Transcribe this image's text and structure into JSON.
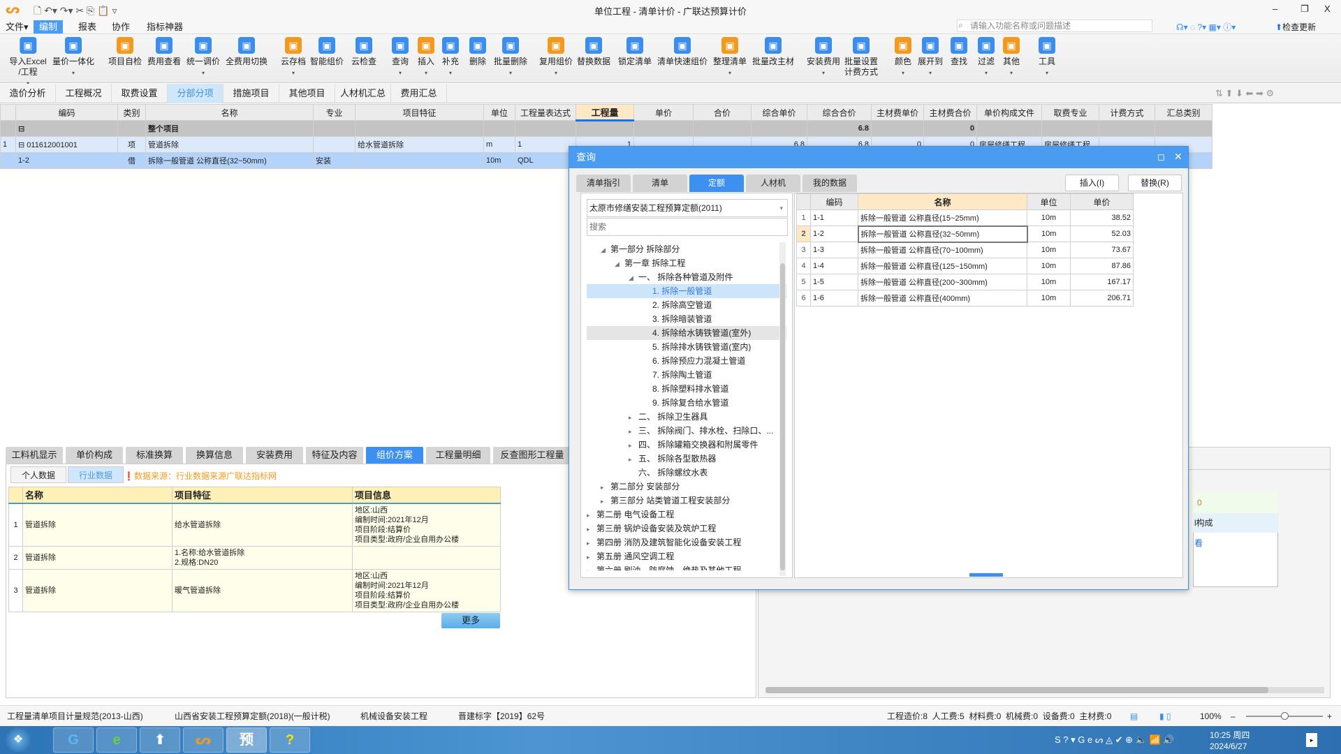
{
  "window": {
    "title": "单位工程 - 清单计价 - 广联达预算计价",
    "search_placeholder": "请输入功能名称或问题描述",
    "check_update": "检查更新"
  },
  "menu": [
    {
      "label": "文件▾"
    },
    {
      "label": "编制",
      "active": true
    },
    {
      "label": "报表"
    },
    {
      "label": "协作"
    },
    {
      "label": "指标神器"
    }
  ],
  "ribbon": [
    {
      "label": "导入Excel\n/工程",
      "icon": "import-excel-icon",
      "dropdown": true
    },
    {
      "label": "量价一体化",
      "icon": "price-integration-icon",
      "dropdown": true
    },
    {
      "label": "项目自检",
      "icon": "self-check-icon"
    },
    {
      "label": "费用查看",
      "icon": "cost-view-icon"
    },
    {
      "label": "统一调价",
      "icon": "adjust-price-icon",
      "dropdown": true
    },
    {
      "label": "全费用切换",
      "icon": "full-cost-switch-icon"
    },
    {
      "label": "云存档",
      "icon": "cloud-upload-icon",
      "dropdown": true
    },
    {
      "label": "智能组价",
      "icon": "smart-pricing-icon"
    },
    {
      "label": "云检查",
      "icon": "cloud-check-icon"
    },
    {
      "label": "查询",
      "icon": "query-icon",
      "dropdown": true
    },
    {
      "label": "插入",
      "icon": "insert-icon",
      "dropdown": true
    },
    {
      "label": "补充",
      "icon": "supplement-icon",
      "dropdown": true
    },
    {
      "label": "删除",
      "icon": "trash-icon"
    },
    {
      "label": "批量删除",
      "icon": "batch-delete-icon",
      "dropdown": true
    },
    {
      "label": "复用组价",
      "icon": "reuse-pricing-icon",
      "dropdown": true
    },
    {
      "label": "替换数据",
      "icon": "replace-data-icon"
    },
    {
      "label": "锁定清单",
      "icon": "lock-icon"
    },
    {
      "label": "清单快速组价",
      "icon": "quick-pricing-icon"
    },
    {
      "label": "整理清单",
      "icon": "organize-list-icon",
      "dropdown": true
    },
    {
      "label": "批量改主材",
      "icon": "batch-edit-material-icon"
    },
    {
      "label": "安装费用",
      "icon": "install-cost-icon",
      "dropdown": true
    },
    {
      "label": "批量设置\n计费方式",
      "icon": "fee-method-icon"
    },
    {
      "label": "颜色",
      "icon": "color-icon",
      "dropdown": true
    },
    {
      "label": "展开到",
      "icon": "expand-to-icon",
      "dropdown": true
    },
    {
      "label": "查找",
      "icon": "find-icon"
    },
    {
      "label": "过滤",
      "icon": "filter-icon",
      "dropdown": true
    },
    {
      "label": "其他",
      "icon": "other-icon",
      "dropdown": true
    },
    {
      "label": "工具",
      "icon": "tools-icon",
      "dropdown": true
    }
  ],
  "nav_tabs": [
    {
      "label": "造价分析"
    },
    {
      "label": "工程概况"
    },
    {
      "label": "取费设置"
    },
    {
      "label": "分部分项",
      "active": true
    },
    {
      "label": "措施项目"
    },
    {
      "label": "其他项目"
    },
    {
      "label": "人材机汇总"
    },
    {
      "label": "费用汇总"
    }
  ],
  "main_table": {
    "columns": [
      "",
      "编码",
      "类别",
      "名称",
      "专业",
      "项目特征",
      "单位",
      "工程量表达式",
      "工程量",
      "单价",
      "合价",
      "综合单价",
      "综合合价",
      "主材费单价",
      "主材费合价",
      "单价构成文件",
      "取费专业",
      "计费方式",
      "汇总类别"
    ],
    "rows": [
      {
        "cells": [
          "",
          "⊟",
          "",
          "整个项目",
          "",
          "",
          "",
          "",
          "",
          "",
          "",
          "",
          "6.8",
          "",
          "0",
          "",
          "",
          "",
          ""
        ]
      },
      {
        "cells": [
          "1",
          "⊟ 011612001001",
          "项",
          "管道拆除",
          "",
          "给水管道拆除",
          "m",
          "1",
          "1",
          "",
          "",
          "6.8",
          "6.8",
          "0",
          "0",
          "房屋修缮工程",
          "房屋修缮工程",
          "",
          ""
        ]
      },
      {
        "cells": [
          "",
          "1-2",
          "借",
          "拆除一般管道 公称直径(32~50mm)",
          "安装",
          "",
          "10m",
          "QDL",
          "",
          "",
          "",
          "",
          "",
          "",
          "",
          "",
          "",
          "",
          ""
        ]
      }
    ]
  },
  "dialog": {
    "title": "查询",
    "tabs": [
      {
        "label": "清单指引"
      },
      {
        "label": "清单"
      },
      {
        "label": "定额",
        "active": true
      },
      {
        "label": "人材机"
      },
      {
        "label": "我的数据"
      }
    ],
    "insert_button": "插入(I)",
    "replace_button": "替换(R)",
    "quota_library": "太原市修缮安装工程预算定额(2011)",
    "search_placeholder": "搜索",
    "tree": [
      {
        "label": "第一部分 拆除部分",
        "level": 2,
        "expander": "◢"
      },
      {
        "label": "第一章 拆除工程",
        "level": 3,
        "expander": "◢"
      },
      {
        "label": "一、 拆除各种管道及附件",
        "level": 4,
        "expander": "◢"
      },
      {
        "label": "1. 拆除一般管道",
        "level": 5,
        "selected": true
      },
      {
        "label": "2. 拆除高空管道",
        "level": 5
      },
      {
        "label": "3. 拆除暗装管道",
        "level": 5
      },
      {
        "label": "4. 拆除给水铸铁管道(室外)",
        "level": 5,
        "hover": true
      },
      {
        "label": "5. 拆除排水铸铁管道(室内)",
        "level": 5
      },
      {
        "label": "6. 拆除预应力混凝土管道",
        "level": 5
      },
      {
        "label": "7. 拆除陶土管道",
        "level": 5
      },
      {
        "label": "8. 拆除塑料排水管道",
        "level": 5
      },
      {
        "label": "9. 拆除复合给水管道",
        "level": 5
      },
      {
        "label": "二、 拆除卫生器具",
        "level": 4,
        "expander": "▸"
      },
      {
        "label": "三、 拆除阀门、排水栓、扫除口、...",
        "level": 4,
        "expander": "▸"
      },
      {
        "label": "四、 拆除罐箱交换器和附属零件",
        "level": 4,
        "expander": "▸"
      },
      {
        "label": "五、 拆除各型散热器",
        "level": 4,
        "expander": "▸"
      },
      {
        "label": "六、 拆除螺纹水表",
        "level": 4
      },
      {
        "label": "第二部分 安装部分",
        "level": 2,
        "expander": "▸"
      },
      {
        "label": "第三部分 站类管道工程安装部分",
        "level": 2,
        "expander": "▸"
      },
      {
        "label": "第二册 电气设备工程",
        "level": 1,
        "expander": "▸"
      },
      {
        "label": "第三册 锅炉设备安装及筑炉工程",
        "level": 1,
        "expander": "▸"
      },
      {
        "label": "第四册 消防及建筑智能化设备安装工程",
        "level": 1,
        "expander": "▸"
      },
      {
        "label": "第五册 通风空调工程",
        "level": 1,
        "expander": "▸"
      },
      {
        "label": "第六册 刷油、防腐蚀、绝热及其他工程",
        "level": 1,
        "expander": "▸"
      }
    ],
    "grid": {
      "columns": [
        "",
        "编码",
        "名称",
        "单位",
        "单价"
      ],
      "rows": [
        {
          "cells": [
            "1",
            "1-1",
            "拆除一般管道 公称直径(15~25mm)",
            "10m",
            "38.52"
          ]
        },
        {
          "cells": [
            "2",
            "1-2",
            "拆除一般管道 公称直径(32~50mm)",
            "10m",
            "52.03"
          ],
          "current": true
        },
        {
          "cells": [
            "3",
            "1-3",
            "拆除一般管道 公称直径(70~100mm)",
            "10m",
            "73.67"
          ]
        },
        {
          "cells": [
            "4",
            "1-4",
            "拆除一般管道 公称直径(125~150mm)",
            "10m",
            "87.86"
          ]
        },
        {
          "cells": [
            "5",
            "1-5",
            "拆除一般管道 公称直径(200~300mm)",
            "10m",
            "167.17"
          ]
        },
        {
          "cells": [
            "6",
            "1-6",
            "拆除一般管道 公称直径(400mm)",
            "10m",
            "206.71"
          ]
        }
      ]
    }
  },
  "bottom": {
    "tabs": [
      {
        "label": "工料机显示"
      },
      {
        "label": "单价构成"
      },
      {
        "label": "标准换算"
      },
      {
        "label": "换算信息"
      },
      {
        "label": "安装费用"
      },
      {
        "label": "特征及内容"
      },
      {
        "label": "组价方案",
        "active": true
      },
      {
        "label": "工程量明细"
      },
      {
        "label": "反查图形工程量"
      }
    ],
    "sub_tabs": [
      {
        "label": "个人数据"
      },
      {
        "label": "行业数据",
        "active": true
      }
    ],
    "source_note": "数据来源：行业数据来源广联达指标网",
    "columns": [
      "",
      "名称",
      "项目特征",
      "项目信息"
    ],
    "rows": [
      {
        "cells": [
          "1",
          "管道拆除",
          "给水管道拆除",
          "地区:山西\n编制时间:2021年12月\n项目阶段:结算价\n项目类型:政府/企业自用办公楼"
        ]
      },
      {
        "cells": [
          "2",
          "管道拆除",
          "1.名称:给水管道拆除\n2.规格:DN20",
          ""
        ]
      },
      {
        "cells": [
          "3",
          "管道拆除",
          "暖气管道拆除",
          "地区:山西\n编制时间:2021年12月\n项目阶段:结算价\n项目类型:政府/企业自用办公楼"
        ]
      }
    ],
    "more_button": "更多",
    "right_fragments": [
      "0",
      "l构成",
      "看"
    ]
  },
  "status": {
    "items": [
      "工程量清单项目计量规范(2013-山西)",
      "山西省安装工程预算定额(2018)(一般计税)",
      "机械设备安装工程",
      "晋建标字【2019】62号"
    ],
    "totals": "工程造价:8  人工费:5  材料费:0  机械费:0  设备费:0  主材费:0",
    "zoom": "100%",
    "zoom_level": 100
  },
  "taskbar": {
    "time": "10:25 周四",
    "date": "2024/6/27"
  },
  "colors": {
    "accent": "#4a9cf0",
    "header_highlight": "#ffe8c6",
    "selected_row": "#b4d3fb",
    "warning": "#f39a1e"
  }
}
